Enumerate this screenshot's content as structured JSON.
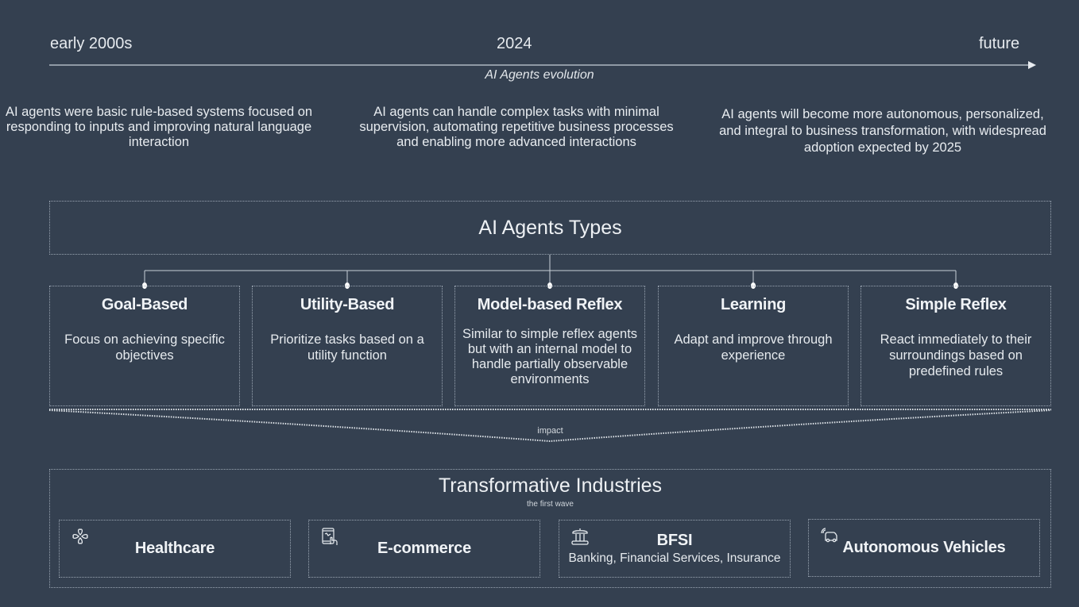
{
  "timeline": {
    "caption": "AI Agents evolution",
    "eras": [
      {
        "label": "early 2000s",
        "description": "AI agents were basic rule-based systems focused on responding to inputs and improving natural language interaction"
      },
      {
        "label": "2024",
        "description": "AI agents can handle complex tasks with minimal supervision, automating repetitive business processes and enabling more advanced interactions"
      },
      {
        "label": "future",
        "description": "AI agents will become more autonomous, personalized, and integral to business transformation, with widespread adoption expected by 2025"
      }
    ]
  },
  "agent_types": {
    "title": "AI Agents Types",
    "items": [
      {
        "title": "Goal-Based",
        "description": "Focus on achieving specific objectives"
      },
      {
        "title": "Utility-Based",
        "description": "Prioritize tasks based on a utility function"
      },
      {
        "title": "Model-based Reflex",
        "description": "Similar to simple reflex agents but with an internal model to handle partially observable environments"
      },
      {
        "title": "Learning",
        "description": "Adapt and improve through experience"
      },
      {
        "title": "Simple Reflex",
        "description": "React immediately to their surroundings based on predefined rules"
      }
    ]
  },
  "impact_label": "impact",
  "industries": {
    "title": "Transformative Industries",
    "subtitle": "the first wave",
    "items": [
      {
        "name": "Healthcare",
        "subtitle": "",
        "icon": "clover-hearts-icon"
      },
      {
        "name": "E-commerce",
        "subtitle": "",
        "icon": "tablet-touch-icon"
      },
      {
        "name": "BFSI",
        "subtitle": "Banking, Financial Services, Insurance",
        "icon": "bank-icon"
      },
      {
        "name": "Autonomous Vehicles",
        "subtitle": "",
        "icon": "connected-car-icon"
      }
    ]
  },
  "colors": {
    "background": "#344050",
    "line": "#c8d0d8",
    "border": "#9aa5b2",
    "text": "#e8ecf0"
  }
}
